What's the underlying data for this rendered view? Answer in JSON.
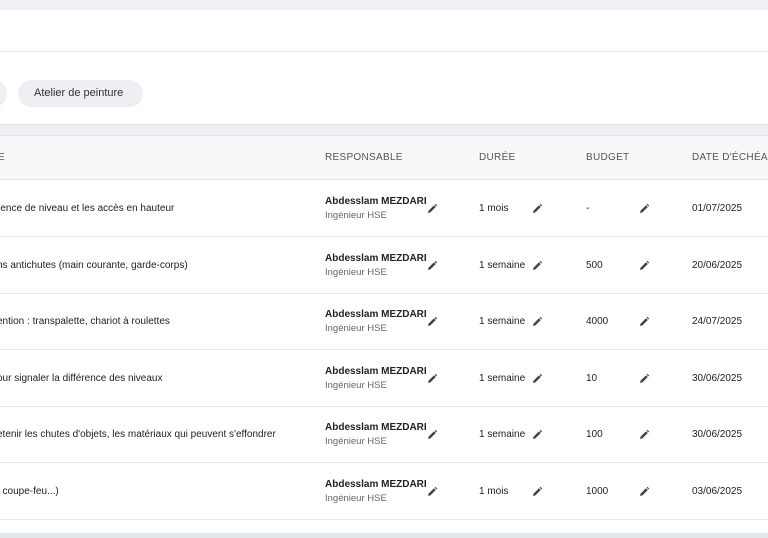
{
  "filters": {
    "chips": [
      "Atelier de peinture"
    ]
  },
  "table": {
    "headers": {
      "action": "E",
      "responsable": "RESPONSABLE",
      "duree": "DURÉE",
      "budget": "BUDGET",
      "echeance": "DATE D'ÉCHÉAN"
    },
    "rows": [
      {
        "description": "rence de niveau et les accès en hauteur",
        "name": "Abdesslam MEZDARI",
        "role": "Ingénieur HSE",
        "duration": "1 mois",
        "budget": "-",
        "date": "01/07/2025"
      },
      {
        "description": "ns antichutes (main courante, garde-corps)",
        "name": "Abdesslam MEZDARI",
        "role": "Ingénieur HSE",
        "duration": "1 semaine",
        "budget": "500",
        "date": "20/06/2025"
      },
      {
        "description": "ention : transpalette, chariot à roulettes",
        "name": "Abdesslam MEZDARI",
        "role": "Ingénieur HSE",
        "duration": "1 semaine",
        "budget": "4000",
        "date": "24/07/2025"
      },
      {
        "description": "our signaler la différence des niveaux",
        "name": "Abdesslam MEZDARI",
        "role": "Ingénieur HSE",
        "duration": "1 semaine",
        "budget": "10",
        "date": "30/06/2025"
      },
      {
        "description": "etenir les chutes d'objets, les matériaux qui peuvent s'effondrer",
        "name": "Abdesslam MEZDARI",
        "role": "Ingénieur HSE",
        "duration": "1 semaine",
        "budget": "100",
        "date": "30/06/2025"
      },
      {
        "description": ", coupe-feu...)",
        "name": "Abdesslam MEZDARI",
        "role": "Ingénieur HSE",
        "duration": "1 mois",
        "budget": "1000",
        "date": "03/06/2025"
      }
    ]
  },
  "icons": {
    "edit": "pencil-icon"
  }
}
